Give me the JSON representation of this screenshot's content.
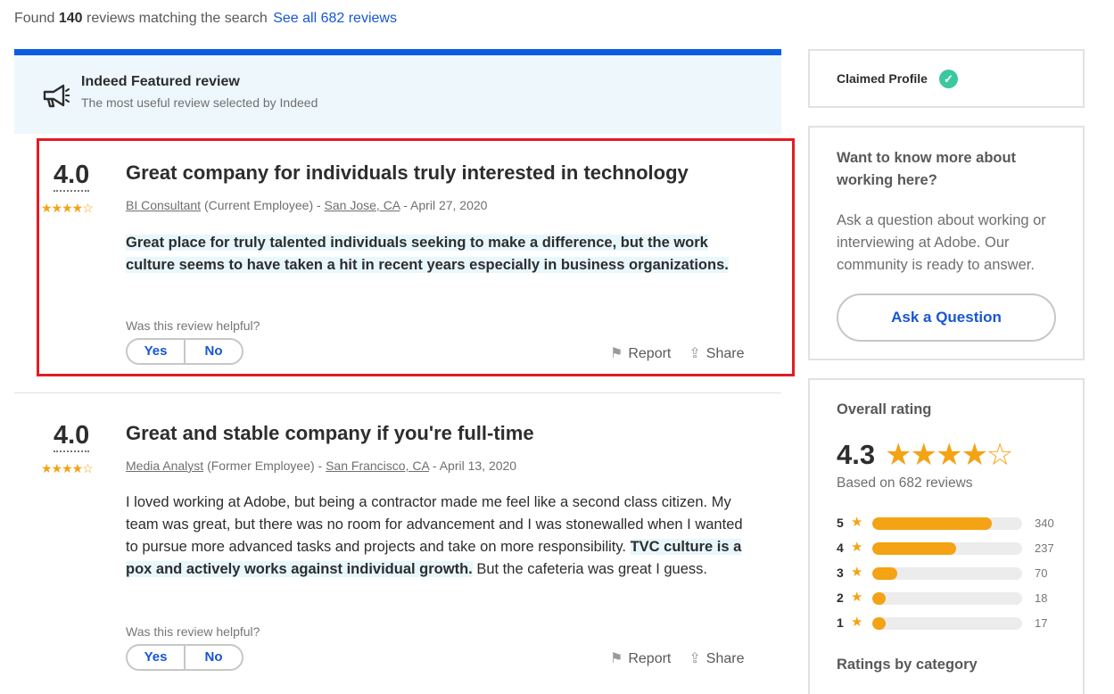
{
  "summary": {
    "prefix": "Found",
    "count": "140",
    "suffix": "reviews matching the search",
    "see_all": "See all 682 reviews"
  },
  "featured": {
    "icon": "megaphone-icon",
    "title": "Indeed Featured review",
    "subtitle": "The most useful review selected by Indeed"
  },
  "reviews": [
    {
      "rating": "4.0",
      "stars": "★★★★☆",
      "title": "Great company for individuals truly interested in technology",
      "job_title": "BI Consultant",
      "status": "(Current Employee) -",
      "location": "San Jose, CA",
      "date": "- April 27, 2020",
      "body_highlight": "Great place for truly talented individuals seeking to make a difference, but the work culture seems to have taken a hit in recent years especially in business organizations.",
      "helpful_prompt": "Was this review helpful?",
      "yes_label": "Yes",
      "no_label": "No",
      "report_label": "Report",
      "share_label": "Share"
    },
    {
      "rating": "4.0",
      "stars": "★★★★☆",
      "title": "Great and stable company if you're full-time",
      "job_title": "Media Analyst",
      "status": "(Former Employee) -",
      "location": "San Francisco, CA",
      "date": "- April 13, 2020",
      "body_before": "I loved working at Adobe, but being a contractor made me feel like a second class citizen. My team was great, but there was no room for advancement and I was stonewalled when I wanted to pursue more advanced tasks and projects and take on more responsibility. ",
      "body_highlight": "TVC culture is a pox and actively works against individual growth.",
      "body_after": " But the cafeteria was great I guess.",
      "helpful_prompt": "Was this review helpful?",
      "yes_label": "Yes",
      "no_label": "No",
      "report_label": "Report",
      "share_label": "Share"
    }
  ],
  "sidebar": {
    "claimed_label": "Claimed Profile",
    "ask_title": "Want to know more about working here?",
    "ask_desc": "Ask a question about working or interviewing at Adobe. Our community is ready to answer.",
    "ask_button": "Ask a Question",
    "overall_title": "Overall rating",
    "overall_score": "4.3",
    "overall_stars": "★★★★☆",
    "overall_based": "Based on 682 reviews",
    "distribution": [
      {
        "level": "5",
        "count": 340
      },
      {
        "level": "4",
        "count": 237
      },
      {
        "level": "3",
        "count": 70
      },
      {
        "level": "2",
        "count": 18
      },
      {
        "level": "1",
        "count": 17
      }
    ],
    "category_title": "Ratings by category"
  },
  "colors": {
    "accent_blue": "#1656d6",
    "star_gold": "#f3a313",
    "highlight_box": "#e21c25",
    "verified_green": "#3cc7a0"
  }
}
